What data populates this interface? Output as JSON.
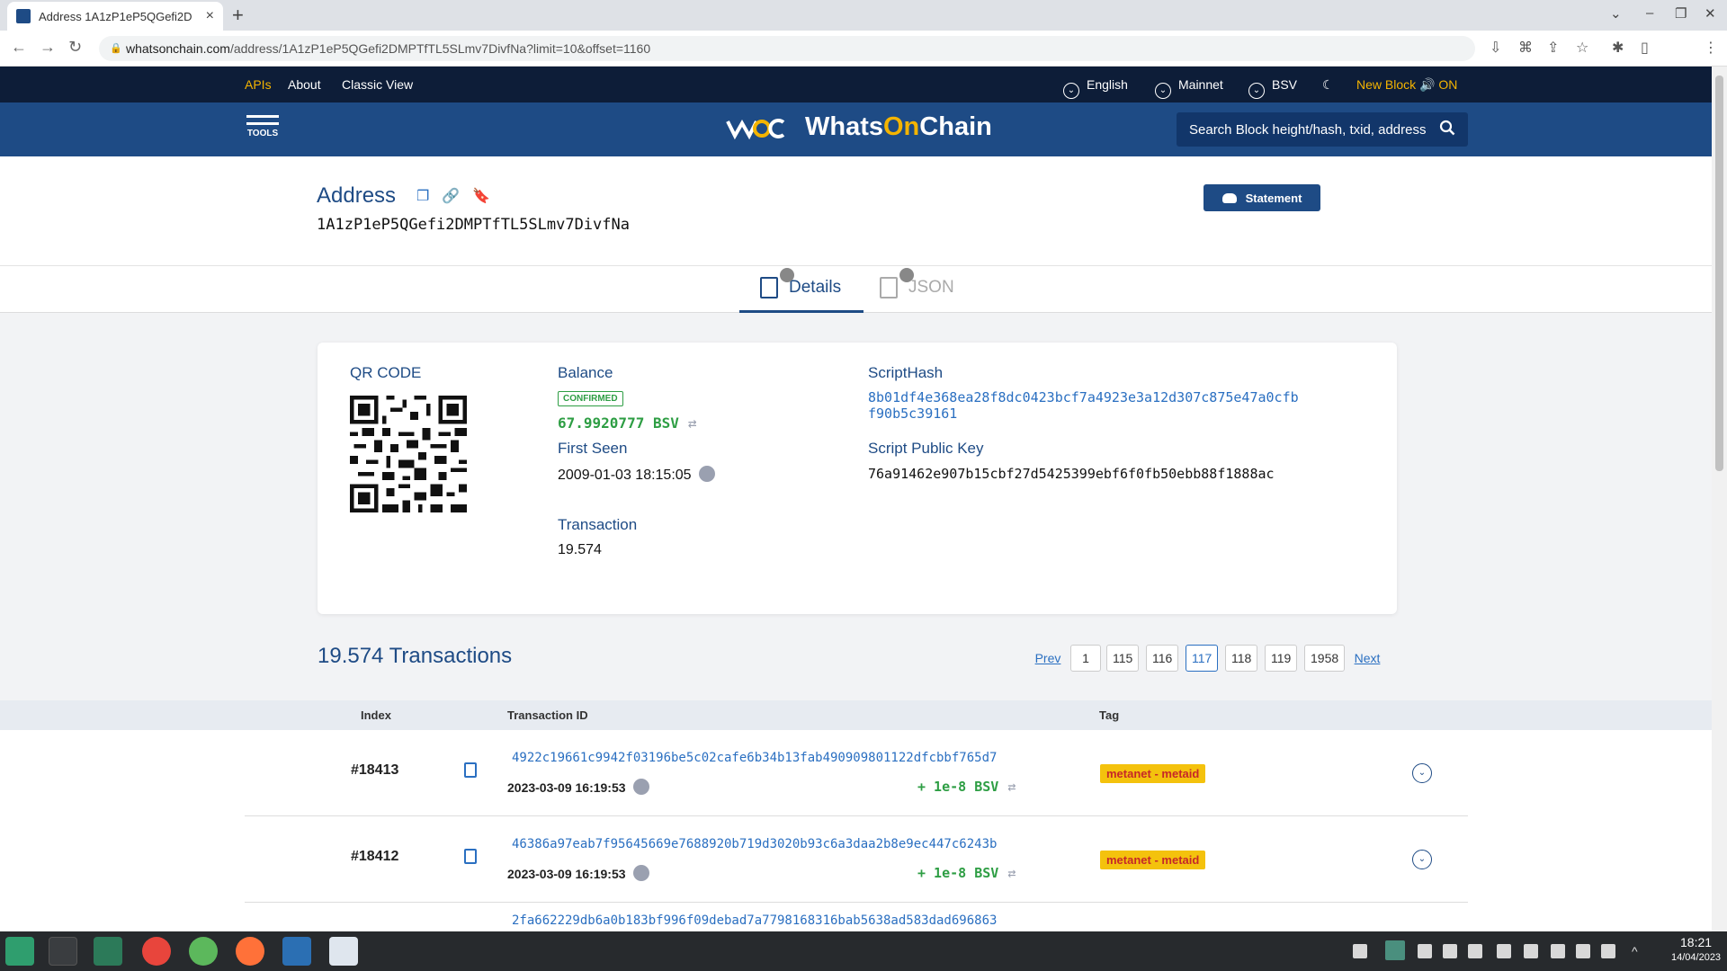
{
  "browser": {
    "tab_title": "Address 1A1zP1eP5QGefi2D",
    "url_domain": "whatsonchain.com",
    "url_path": "/address/1A1zP1eP5QGefi2DMPTfTL5SLmv7DivfNa?limit=10&offset=1160"
  },
  "topnav": {
    "apis": "APIs",
    "about": "About",
    "classic": "Classic View",
    "language": "English",
    "network": "Mainnet",
    "currency": "BSV",
    "new_block": "New Block",
    "new_block_state": "ON"
  },
  "header": {
    "tools_label": "TOOLS",
    "logo_prefix": "Whats",
    "logo_on": "On",
    "logo_suffix": "Chain",
    "search_placeholder": "Search Block height/hash, txid, address"
  },
  "address": {
    "title": "Address",
    "value": "1A1zP1eP5QGefi2DMPTfTL5SLmv7DivfNa",
    "statement_label": "Statement"
  },
  "page_tabs": {
    "details": "Details",
    "json": "JSON"
  },
  "details": {
    "qr_label": "QR CODE",
    "balance_label": "Balance",
    "confirmed_label": "CONFIRMED",
    "balance_value": "67.9920777 BSV",
    "first_seen_label": "First Seen",
    "first_seen_value": "2009-01-03 18:15:05",
    "transaction_label": "Transaction",
    "transaction_value": "19.574",
    "scripthash_label": "ScriptHash",
    "scripthash_line1": "8b01df4e368ea28f8dc0423bcf7a4923e3a12d307c875e47a0cfb",
    "scripthash_line2": "f90b5c39161",
    "spk_label": "Script Public Key",
    "spk_value": "76a91462e907b15cbf27d5425399ebf6f0fb50ebb88f1888ac"
  },
  "transactions": {
    "title": "19.574 Transactions",
    "pagination": {
      "prev": "Prev",
      "next": "Next",
      "pages": [
        "1",
        "115",
        "116",
        "117",
        "118",
        "119",
        "1958"
      ],
      "current": "117"
    },
    "columns": {
      "index": "Index",
      "txid": "Transaction ID",
      "tag": "Tag"
    },
    "rows": [
      {
        "index": "#18413",
        "txid": "4922c19661c9942f03196be5c02cafe6b34b13fab490909801122dfcbbf765d7",
        "date": "2023-03-09 16:19:53",
        "amount": "+ 1e-8 BSV",
        "tag": "metanet - metaid"
      },
      {
        "index": "#18412",
        "txid": "46386a97eab7f95645669e7688920b719d3020b93c6a3daa2b8e9ec447c6243b",
        "date": "2023-03-09 16:19:53",
        "amount": "+ 1e-8 BSV",
        "tag": "metanet - metaid"
      },
      {
        "txid": "2fa662229db6a0b183bf996f09debad7a7798168316bab5638ad583dad696863"
      }
    ]
  },
  "taskbar": {
    "time": "18:21",
    "date": "14/04/2023"
  },
  "colors": {
    "brand_dark": "#0d1d38",
    "brand": "#1e4b85",
    "accent_yellow": "#f4b400",
    "green": "#2e9e44",
    "link": "#2a6fc1"
  }
}
